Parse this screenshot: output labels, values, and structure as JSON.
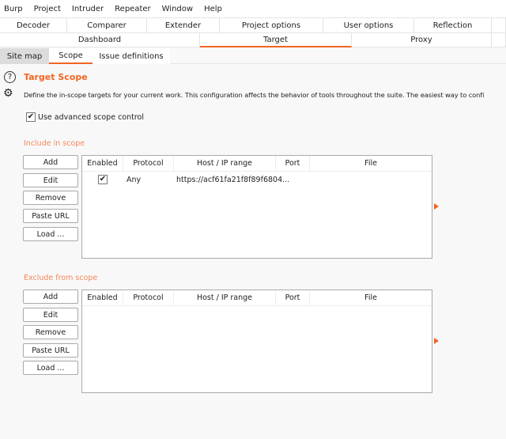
{
  "menu": [
    "Burp",
    "Project",
    "Intruder",
    "Repeater",
    "Window",
    "Help"
  ],
  "tabs_row1": [
    "Decoder",
    "Comparer",
    "Extender",
    "Project options",
    "User options",
    "Reflection",
    ""
  ],
  "tabs_row2": [
    "Dashboard",
    "Target",
    "Proxy",
    ""
  ],
  "subtabs": [
    "Site map",
    "Scope",
    "Issue definitions"
  ],
  "scope": {
    "title": "Target Scope",
    "description": "Define the in-scope targets for your current work. This configuration affects the behavior of tools throughout the suite. The easiest way to confi",
    "advanced_label": "Use advanced scope control",
    "advanced_checked": true,
    "help_icon": "question-circle-icon",
    "settings_icon": "gear-icon",
    "accent": "#f26522"
  },
  "buttons": [
    "Add",
    "Edit",
    "Remove",
    "Paste URL",
    "Load ..."
  ],
  "columns": [
    "Enabled",
    "Protocol",
    "Host / IP range",
    "Port",
    "File"
  ],
  "include": {
    "label": "Include in scope",
    "rows": [
      {
        "enabled": true,
        "protocol": "Any",
        "host": "https://acf61fa21f8f89f6804...",
        "port": "",
        "file": ""
      }
    ]
  },
  "exclude": {
    "label": "Exclude from scope",
    "rows": []
  }
}
